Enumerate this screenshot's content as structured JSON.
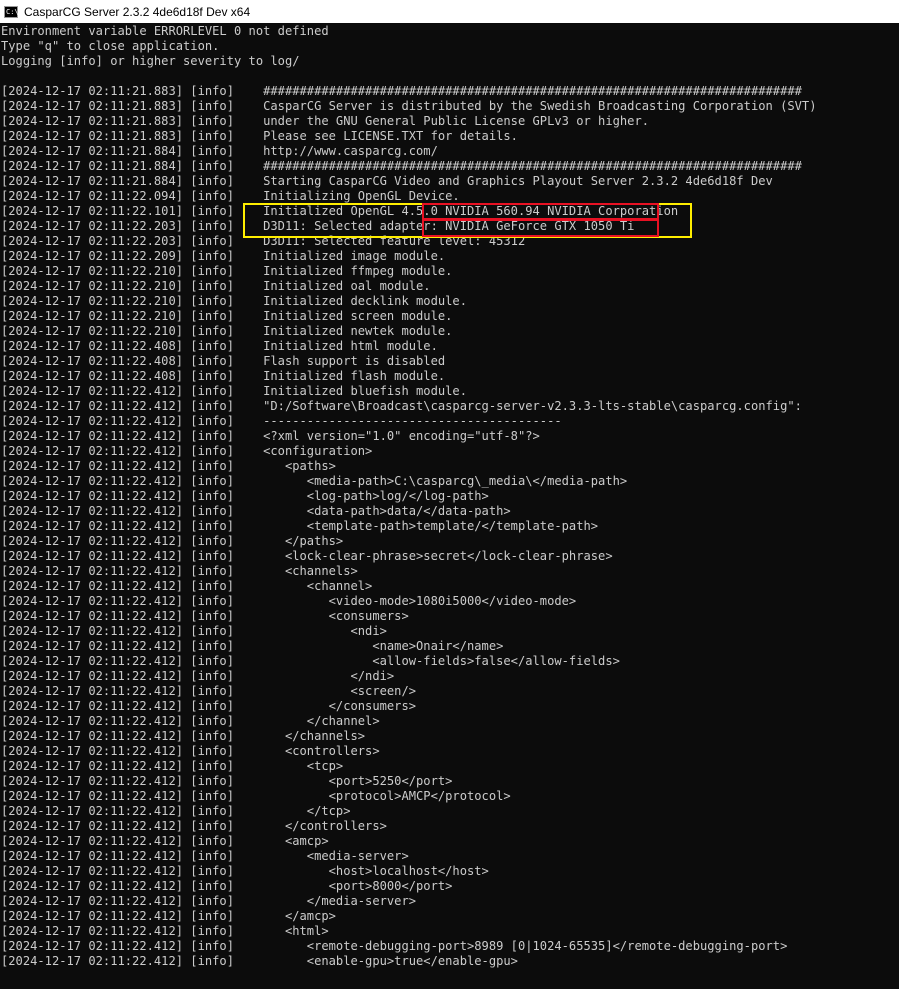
{
  "window": {
    "title": "CasparCG Server 2.3.2 4de6d18f Dev x64",
    "icon": "console-app-icon",
    "icon_text": "C:\\"
  },
  "colors": {
    "console_bg": "#0c0c0c",
    "console_text": "#cccccc",
    "highlight_yellow": "#ffee00",
    "highlight_red": "#e81123"
  },
  "console": {
    "lines": [
      "Environment variable ERRORLEVEL 0 not defined",
      "Type \"q\" to close application.",
      "Logging [info] or higher severity to log/",
      "",
      "[2024-12-17 02:11:21.883] [info]    ##########################################################################",
      "[2024-12-17 02:11:21.883] [info]    CasparCG Server is distributed by the Swedish Broadcasting Corporation (SVT)",
      "[2024-12-17 02:11:21.883] [info]    under the GNU General Public License GPLv3 or higher.",
      "[2024-12-17 02:11:21.883] [info]    Please see LICENSE.TXT for details.",
      "[2024-12-17 02:11:21.884] [info]    http://www.casparcg.com/",
      "[2024-12-17 02:11:21.884] [info]    ##########################################################################",
      "[2024-12-17 02:11:21.884] [info]    Starting CasparCG Video and Graphics Playout Server 2.3.2 4de6d18f Dev",
      "[2024-12-17 02:11:22.094] [info]    Initializing OpenGL Device.",
      "[2024-12-17 02:11:22.101] [info]    Initialized OpenGL 4.5.0 NVIDIA 560.94 NVIDIA Corporation",
      "[2024-12-17 02:11:22.203] [info]    D3D11: Selected adapter: NVIDIA GeForce GTX 1050 Ti",
      "[2024-12-17 02:11:22.203] [info]    D3D11: Selected feature level: 45312",
      "[2024-12-17 02:11:22.209] [info]    Initialized image module.",
      "[2024-12-17 02:11:22.210] [info]    Initialized ffmpeg module.",
      "[2024-12-17 02:11:22.210] [info]    Initialized oal module.",
      "[2024-12-17 02:11:22.210] [info]    Initialized decklink module.",
      "[2024-12-17 02:11:22.210] [info]    Initialized screen module.",
      "[2024-12-17 02:11:22.210] [info]    Initialized newtek module.",
      "[2024-12-17 02:11:22.408] [info]    Initialized html module.",
      "[2024-12-17 02:11:22.408] [info]    Flash support is disabled",
      "[2024-12-17 02:11:22.408] [info]    Initialized flash module.",
      "[2024-12-17 02:11:22.412] [info]    Initialized bluefish module.",
      "[2024-12-17 02:11:22.412] [info]    \"D:/Software\\Broadcast\\casparcg-server-v2.3.3-lts-stable\\casparcg.config\":",
      "[2024-12-17 02:11:22.412] [info]    -----------------------------------------",
      "[2024-12-17 02:11:22.412] [info]    <?xml version=\"1.0\" encoding=\"utf-8\"?>",
      "[2024-12-17 02:11:22.412] [info]    <configuration>",
      "[2024-12-17 02:11:22.412] [info]       <paths>",
      "[2024-12-17 02:11:22.412] [info]          <media-path>C:\\casparcg\\_media\\</media-path>",
      "[2024-12-17 02:11:22.412] [info]          <log-path>log/</log-path>",
      "[2024-12-17 02:11:22.412] [info]          <data-path>data/</data-path>",
      "[2024-12-17 02:11:22.412] [info]          <template-path>template/</template-path>",
      "[2024-12-17 02:11:22.412] [info]       </paths>",
      "[2024-12-17 02:11:22.412] [info]       <lock-clear-phrase>secret</lock-clear-phrase>",
      "[2024-12-17 02:11:22.412] [info]       <channels>",
      "[2024-12-17 02:11:22.412] [info]          <channel>",
      "[2024-12-17 02:11:22.412] [info]             <video-mode>1080i5000</video-mode>",
      "[2024-12-17 02:11:22.412] [info]             <consumers>",
      "[2024-12-17 02:11:22.412] [info]                <ndi>",
      "[2024-12-17 02:11:22.412] [info]                   <name>Onair</name>",
      "[2024-12-17 02:11:22.412] [info]                   <allow-fields>false</allow-fields>",
      "[2024-12-17 02:11:22.412] [info]                </ndi>",
      "[2024-12-17 02:11:22.412] [info]                <screen/>",
      "[2024-12-17 02:11:22.412] [info]             </consumers>",
      "[2024-12-17 02:11:22.412] [info]          </channel>",
      "[2024-12-17 02:11:22.412] [info]       </channels>",
      "[2024-12-17 02:11:22.412] [info]       <controllers>",
      "[2024-12-17 02:11:22.412] [info]          <tcp>",
      "[2024-12-17 02:11:22.412] [info]             <port>5250</port>",
      "[2024-12-17 02:11:22.412] [info]             <protocol>AMCP</protocol>",
      "[2024-12-17 02:11:22.412] [info]          </tcp>",
      "[2024-12-17 02:11:22.412] [info]       </controllers>",
      "[2024-12-17 02:11:22.412] [info]       <amcp>",
      "[2024-12-17 02:11:22.412] [info]          <media-server>",
      "[2024-12-17 02:11:22.412] [info]             <host>localhost</host>",
      "[2024-12-17 02:11:22.412] [info]             <port>8000</port>",
      "[2024-12-17 02:11:22.412] [info]          </media-server>",
      "[2024-12-17 02:11:22.412] [info]       </amcp>",
      "[2024-12-17 02:11:22.412] [info]       <html>",
      "[2024-12-17 02:11:22.412] [info]          <remote-debugging-port>8989 [0|1024-65535]</remote-debugging-port>",
      "[2024-12-17 02:11:22.412] [info]          <enable-gpu>true</enable-gpu>"
    ]
  }
}
